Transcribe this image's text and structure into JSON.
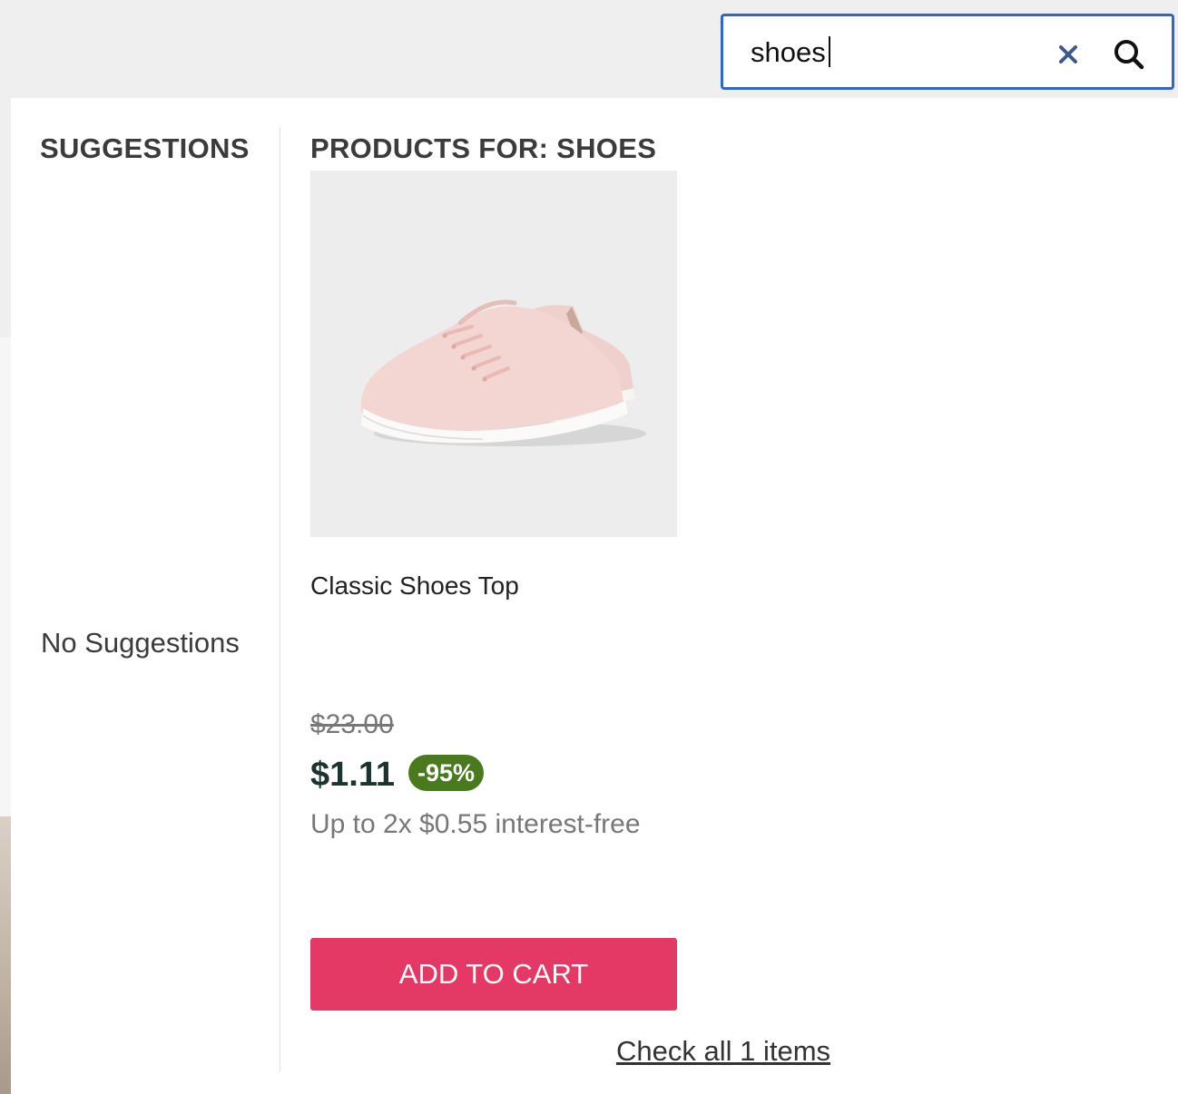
{
  "search": {
    "value": "shoes",
    "clear_icon": "close-icon",
    "submit_icon": "search-icon",
    "border_color": "#3366cc"
  },
  "suggestions": {
    "heading": "SUGGESTIONS",
    "empty_text": "No Suggestions"
  },
  "products": {
    "heading": "PRODUCTS FOR: SHOES",
    "items": [
      {
        "title": "Classic Shoes Top",
        "image_icon": "sneaker-image",
        "price_original": "$23.00",
        "price_current": "$1.11",
        "discount": "-95%",
        "installments": "Up to 2x $0.55 interest-free",
        "add_to_cart_label": "ADD TO CART"
      }
    ],
    "check_all_label": "Check all 1 items"
  },
  "colors": {
    "accent": "#e53965",
    "discount_badge": "#4a7a1e",
    "price": "#1d3330"
  }
}
